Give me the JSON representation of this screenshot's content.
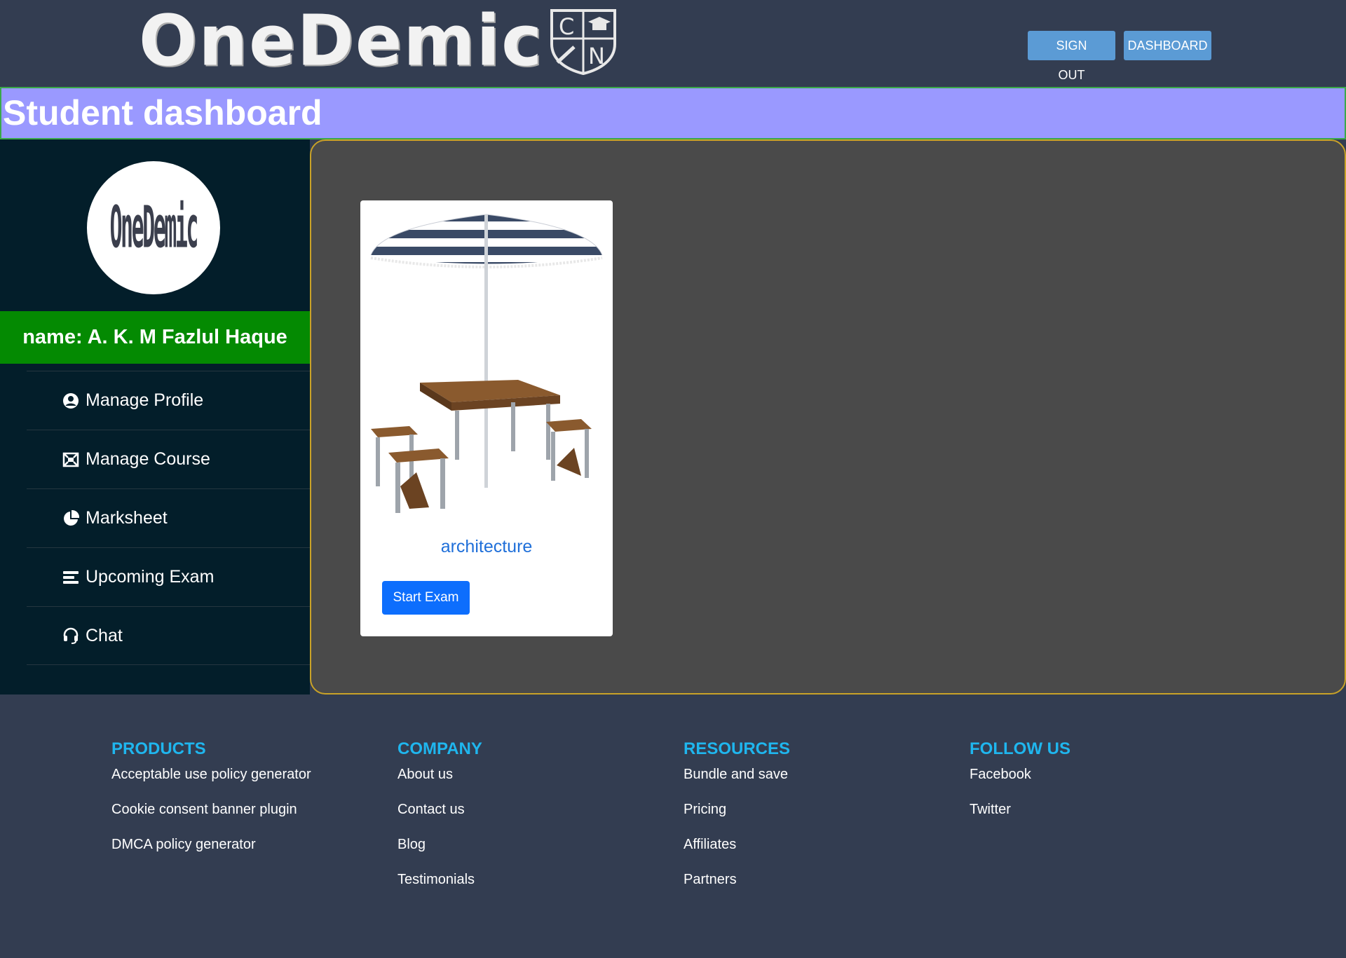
{
  "header": {
    "logo_text": "OneDemic",
    "crest_letters": [
      "C",
      "N"
    ],
    "sign_out_label": "SIGN OUT",
    "dashboard_label": "DASHBOARD"
  },
  "page_title": "Student dashboard",
  "sidebar": {
    "avatar_text": "OneDemic",
    "student_name": "name: A. K. M Fazlul Haque",
    "menu": [
      {
        "label": "Manage Profile",
        "icon": "user-circle-icon"
      },
      {
        "label": "Manage Course",
        "icon": "course-icon"
      },
      {
        "label": "Marksheet",
        "icon": "pie-chart-icon"
      },
      {
        "label": "Upcoming Exam",
        "icon": "list-icon"
      },
      {
        "label": "Chat",
        "icon": "headset-icon"
      }
    ]
  },
  "main": {
    "cards": [
      {
        "title": "architecture",
        "button_label": "Start Exam",
        "image": "picnic-table-umbrella"
      }
    ]
  },
  "footer": {
    "columns": [
      {
        "heading": "PRODUCTS",
        "links": [
          "Acceptable use policy generator",
          "Cookie consent banner plugin",
          "DMCA policy generator"
        ]
      },
      {
        "heading": "COMPANY",
        "links": [
          "About us",
          "Contact us",
          "Blog",
          "Testimonials"
        ]
      },
      {
        "heading": "RESOURCES",
        "links": [
          "Bundle and save",
          "Pricing",
          "Affiliates",
          "Partners"
        ]
      },
      {
        "heading": "FOLLOW US",
        "links": [
          "Facebook",
          "Twitter"
        ]
      }
    ]
  },
  "colors": {
    "page_bg": "#333d51",
    "title_band": "#9a99ff",
    "sidebar_bg": "#031e2a",
    "name_bar": "#048a02",
    "main_panel": "#4a4a4a",
    "panel_border": "#c9a227",
    "header_button": "#5b9bd5",
    "primary_button": "#0d6efd",
    "footer_heading": "#1fb6ee"
  }
}
